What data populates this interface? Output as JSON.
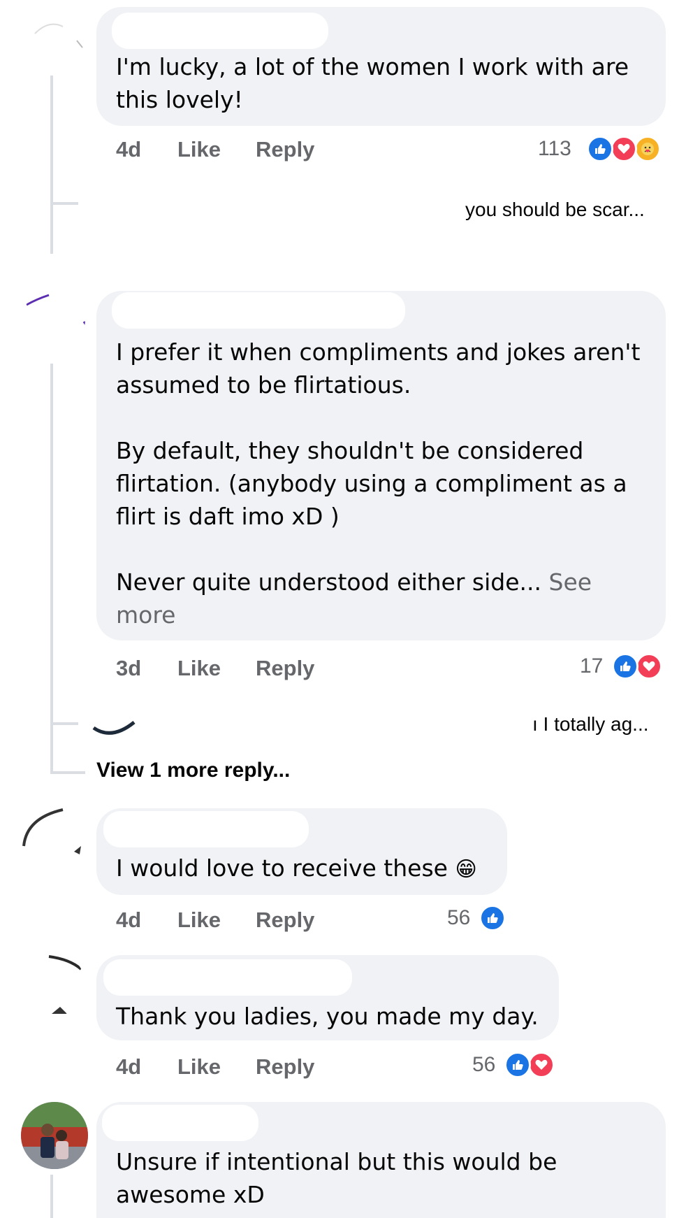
{
  "comments": [
    {
      "text": "I'm lucky, a lot of the women I work with are\nthis lovely!",
      "age": "4d",
      "like": "Like",
      "reply": "Reply",
      "count": "113",
      "reactions": [
        "like-icon",
        "love-icon",
        "care-icon"
      ],
      "reply_preview": "you should be scar..."
    },
    {
      "text": "I prefer it when compliments and jokes aren't\nassumed to be flirtatious.\n\nBy default, they shouldn't be considered\nflirtation. (anybody using a compliment as a\nflirt is daft imo xD )\n\nNever quite understood either side...",
      "see_more": " See\nmore",
      "age": "3d",
      "like": "Like",
      "reply": "Reply",
      "count": "17",
      "reactions": [
        "like-icon",
        "love-icon"
      ],
      "reply_preview": "ı I totally ag...",
      "view_more": "View 1 more reply..."
    },
    {
      "text": "I would love to receive these",
      "emoji": "😁",
      "age": "4d",
      "like": "Like",
      "reply": "Reply",
      "count": "56",
      "reactions": [
        "like-icon"
      ]
    },
    {
      "text": "Thank you ladies, you made my day.",
      "age": "4d",
      "like": "Like",
      "reply": "Reply",
      "count": "56",
      "reactions": [
        "like-icon",
        "love-icon"
      ]
    },
    {
      "text": "Unsure if intentional but this would be\nawesome xD"
    }
  ],
  "colors": {
    "bubble": "#f0f2f5",
    "meta": "#65676b",
    "like": "#1b74e4",
    "love": "#f33e58",
    "care": "#f7b125",
    "line": "#dadde1"
  }
}
